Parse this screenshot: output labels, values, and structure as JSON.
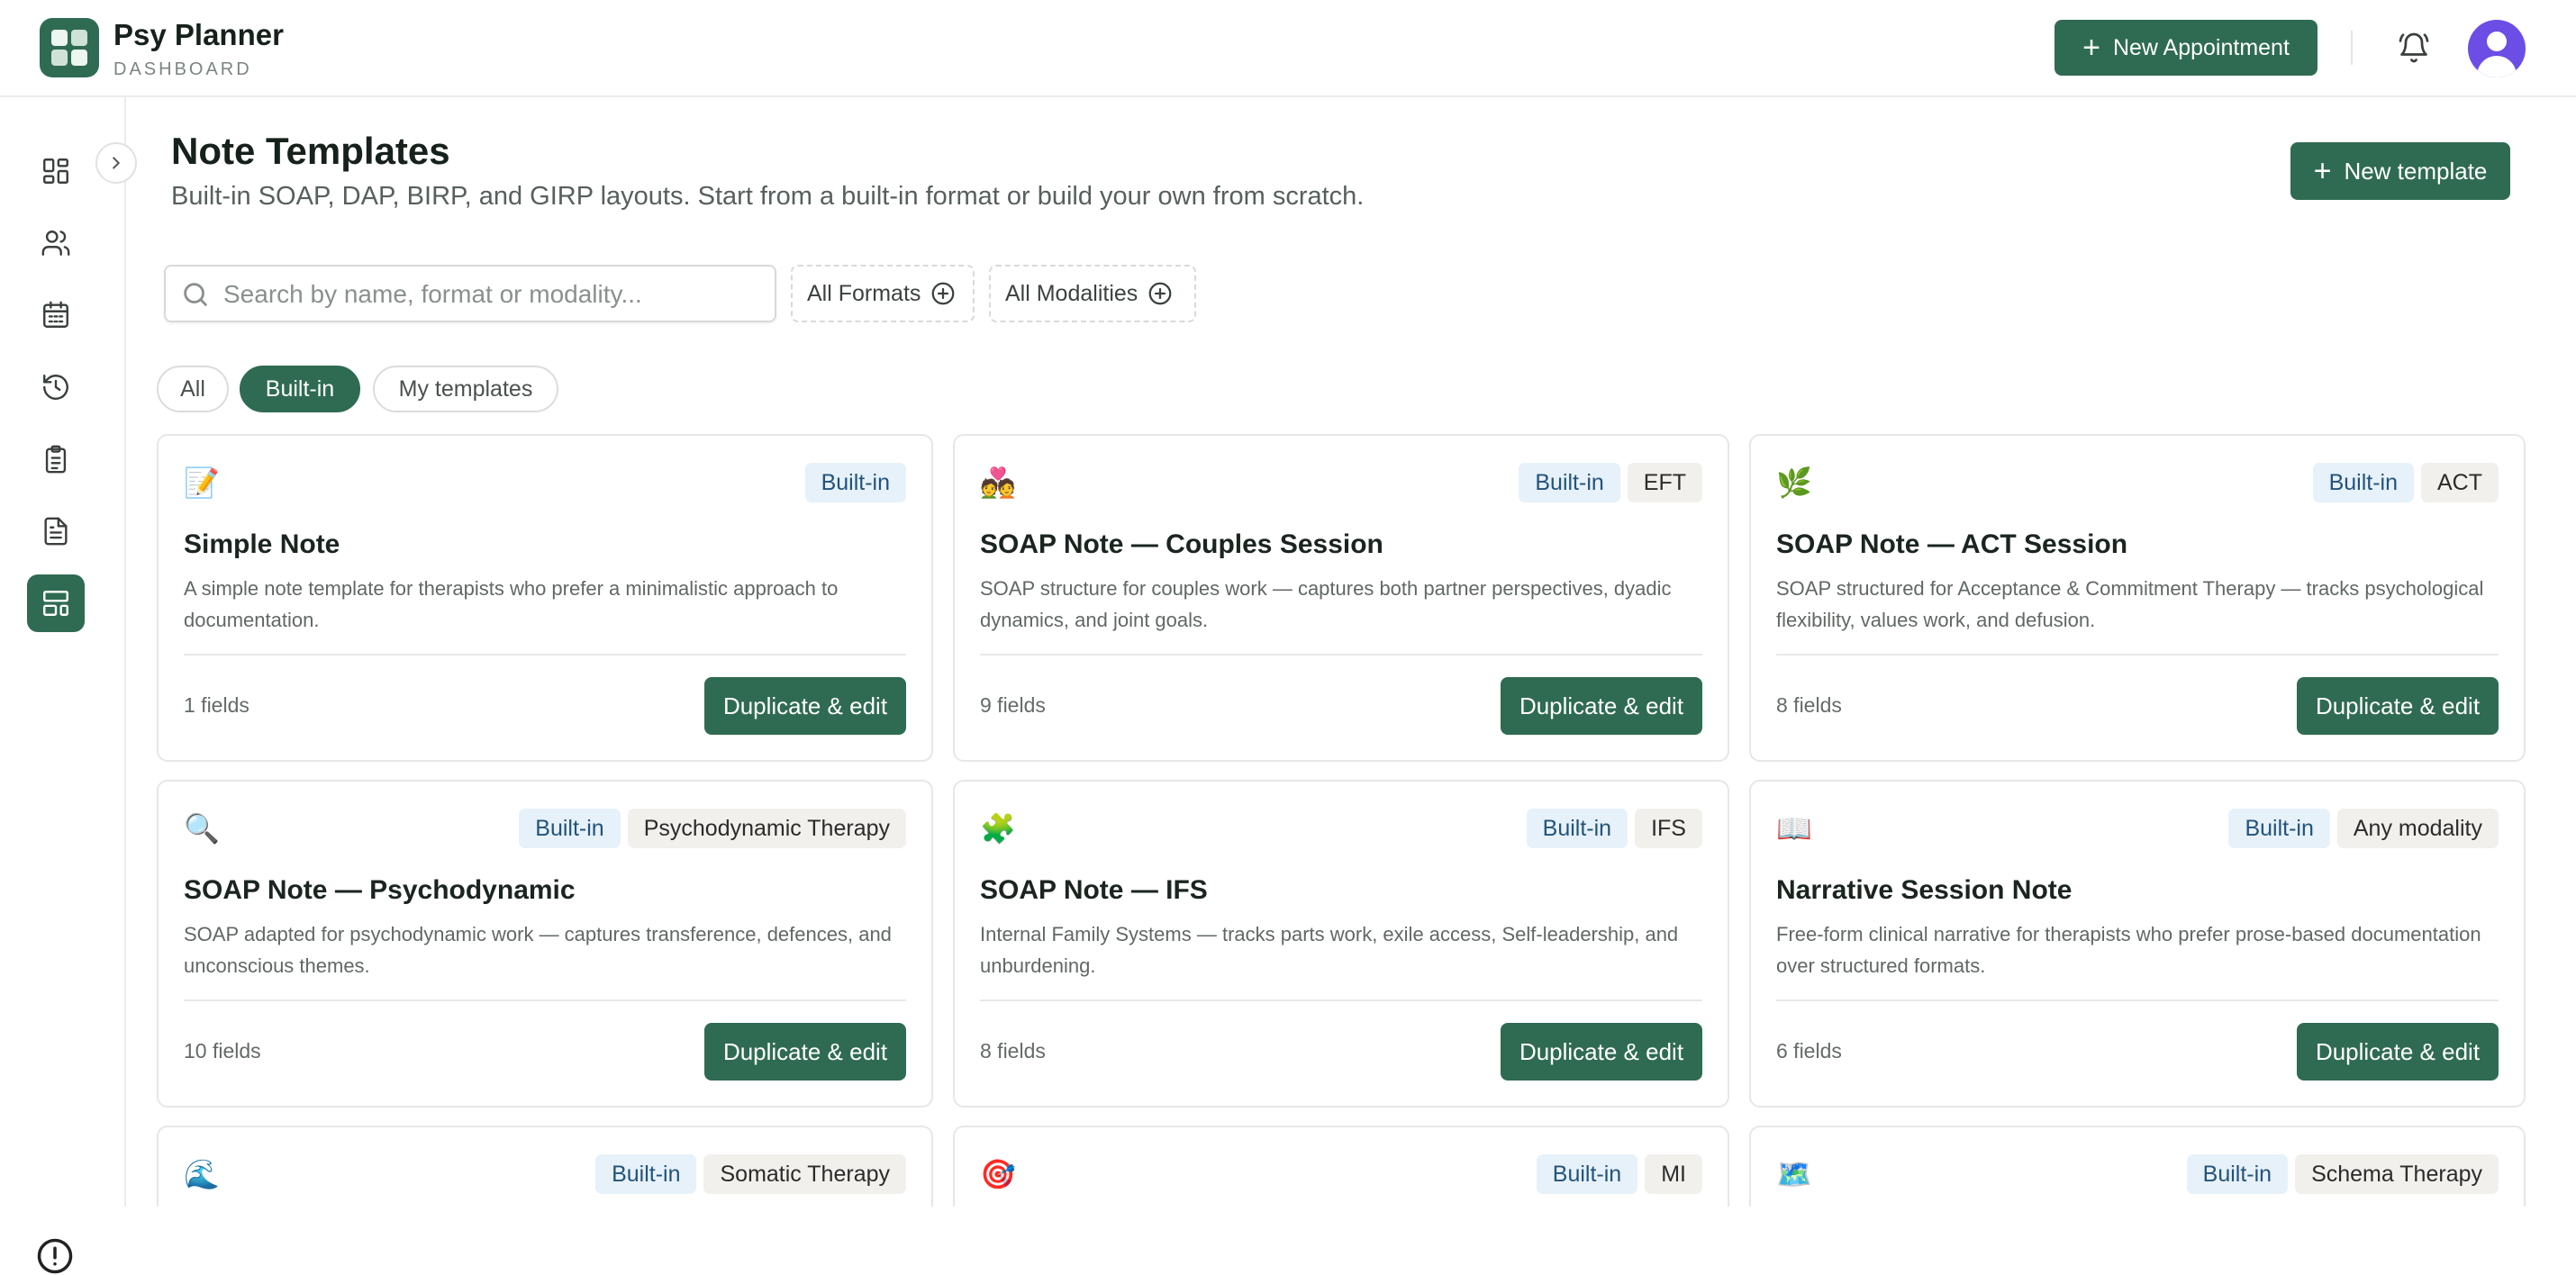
{
  "app": {
    "title": "Psy Planner",
    "subtitle": "DASHBOARD",
    "new_appointment_label": "New Appointment",
    "accent_color": "#2f6b52"
  },
  "sidebar": {
    "items": [
      {
        "name": "dashboard",
        "icon": "dashboard-grid-icon"
      },
      {
        "name": "clients",
        "icon": "users-icon"
      },
      {
        "name": "calendar",
        "icon": "calendar-icon"
      },
      {
        "name": "history",
        "icon": "history-icon"
      },
      {
        "name": "notes",
        "icon": "clipboard-icon"
      },
      {
        "name": "documents",
        "icon": "document-icon"
      },
      {
        "name": "templates",
        "icon": "layout-template-icon",
        "active": true
      }
    ],
    "footer_icon": "info-circle-icon"
  },
  "page": {
    "title": "Note Templates",
    "subtitle": "Built-in SOAP, DAP, BIRP, and GIRP layouts. Start from a built-in format or build your own from scratch.",
    "new_template_label": "New template"
  },
  "filters": {
    "search_placeholder": "Search by name, format or modality...",
    "search_value": "",
    "format_label": "All Formats",
    "modality_label": "All Modalities"
  },
  "tabs": [
    {
      "label": "All",
      "selected": false
    },
    {
      "label": "Built-in",
      "selected": true
    },
    {
      "label": "My templates",
      "selected": false
    }
  ],
  "cards": [
    {
      "emoji": "📝",
      "badges": [
        "Built-in"
      ],
      "title": "Simple Note",
      "description": "A simple note template for therapists who prefer a minimalistic approach to documentation.",
      "fields": "1 fields",
      "action": "Duplicate & edit"
    },
    {
      "emoji": "💑",
      "badges": [
        "Built-in",
        "EFT"
      ],
      "title": "SOAP Note — Couples Session",
      "description": "SOAP structure for couples work — captures both partner perspectives, dyadic dynamics, and joint goals.",
      "fields": "9 fields",
      "action": "Duplicate & edit"
    },
    {
      "emoji": "🌿",
      "badges": [
        "Built-in",
        "ACT"
      ],
      "title": "SOAP Note — ACT Session",
      "description": "SOAP structured for Acceptance & Commitment Therapy — tracks psychological flexibility, values work, and defusion.",
      "fields": "8 fields",
      "action": "Duplicate & edit"
    },
    {
      "emoji": "🔍",
      "badges": [
        "Built-in",
        "Psychodynamic Therapy"
      ],
      "title": "SOAP Note — Psychodynamic",
      "description": "SOAP adapted for psychodynamic work — captures transference, defences, and unconscious themes.",
      "fields": "10 fields",
      "action": "Duplicate & edit"
    },
    {
      "emoji": "🧩",
      "badges": [
        "Built-in",
        "IFS"
      ],
      "title": "SOAP Note — IFS",
      "description": "Internal Family Systems — tracks parts work, exile access, Self-leadership, and unburdening.",
      "fields": "8 fields",
      "action": "Duplicate & edit"
    },
    {
      "emoji": "📖",
      "badges": [
        "Built-in",
        "Any modality"
      ],
      "title": "Narrative Session Note",
      "description": "Free-form clinical narrative for therapists who prefer prose-based documentation over structured formats.",
      "fields": "6 fields",
      "action": "Duplicate & edit"
    },
    {
      "emoji": "🌊",
      "badges": [
        "Built-in",
        "Somatic Therapy"
      ],
      "title": "",
      "description": "",
      "fields": "",
      "action": ""
    },
    {
      "emoji": "🎯",
      "badges": [
        "Built-in",
        "MI"
      ],
      "title": "",
      "description": "",
      "fields": "",
      "action": ""
    },
    {
      "emoji": "🗺️",
      "badges": [
        "Built-in",
        "Schema Therapy"
      ],
      "title": "",
      "description": "",
      "fields": "",
      "action": ""
    }
  ]
}
